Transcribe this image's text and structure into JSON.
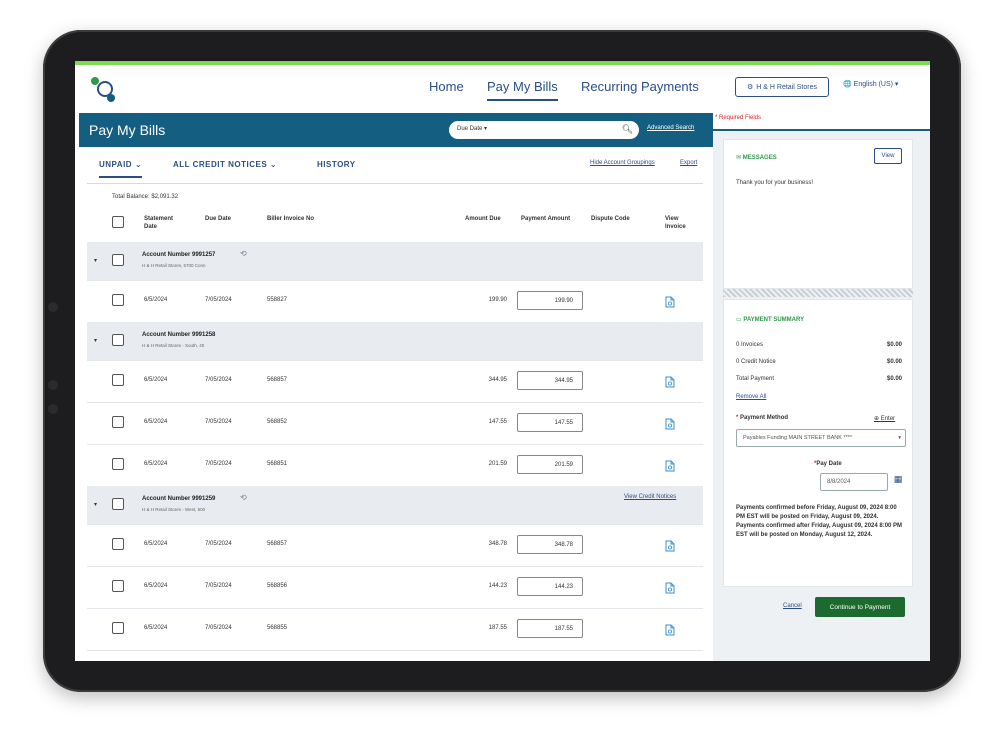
{
  "nav": {
    "home": "Home",
    "pay_my_bills": "Pay My Bills",
    "recurring": "Recurring Payments",
    "store": "H & H Retail Stores",
    "language": "English (US) ▾"
  },
  "header": {
    "title": "Pay My Bills",
    "search_select": "Due Date ▾",
    "advanced_search": "Advanced Search",
    "required": "* Required Fields"
  },
  "tabs": {
    "unpaid": "UNPAID",
    "credit_notices": "ALL CREDIT NOTICES",
    "history": "HISTORY",
    "hide_link": "Hide Account Groupings",
    "export": "Export"
  },
  "total_balance": "Total Balance: $2,091.32",
  "columns": {
    "statement_date": "Statement Date",
    "due_date": "Due Date",
    "biller_invoice": "Biller Invoice No",
    "amount_due": "Amount Due",
    "payment_amount": "Payment Amount",
    "dispute_code": "Dispute Code",
    "view_invoice": "View Invoice"
  },
  "groups": [
    {
      "account": "Account Number 9991257",
      "sub": "H & H Retail Stores, 5700 Conn",
      "recurring": true,
      "credit_link": "",
      "rows": [
        {
          "statement": "6/5/2024",
          "due": "7/05/2024",
          "invoice": "558827",
          "amount": "199.90",
          "payment": "199.90"
        }
      ]
    },
    {
      "account": "Account Number 9991258",
      "sub": "H & H Retail Stores - South, 40",
      "recurring": false,
      "credit_link": "",
      "rows": [
        {
          "statement": "6/5/2024",
          "due": "7/05/2024",
          "invoice": "568857",
          "amount": "344.95",
          "payment": "344.95"
        },
        {
          "statement": "6/5/2024",
          "due": "7/05/2024",
          "invoice": "568852",
          "amount": "147.55",
          "payment": "147.55"
        },
        {
          "statement": "6/5/2024",
          "due": "7/05/2024",
          "invoice": "568851",
          "amount": "201.59",
          "payment": "201.59"
        }
      ]
    },
    {
      "account": "Account Number 9991259",
      "sub": "H & H Retail Stores - West, 500",
      "recurring": true,
      "credit_link": "View Credit Notices",
      "rows": [
        {
          "statement": "6/5/2024",
          "due": "7/05/2024",
          "invoice": "568857",
          "amount": "348.78",
          "payment": "348.78"
        },
        {
          "statement": "6/5/2024",
          "due": "7/05/2024",
          "invoice": "568856",
          "amount": "144.23",
          "payment": "144.23"
        },
        {
          "statement": "6/5/2024",
          "due": "7/05/2024",
          "invoice": "568855",
          "amount": "187.55",
          "payment": "187.55"
        }
      ]
    }
  ],
  "messages": {
    "title": "MESSAGES",
    "view": "View",
    "text": "Thank you for your business!"
  },
  "summary": {
    "title": "PAYMENT SUMMARY",
    "invoices_label": "0 Invoices",
    "invoices_value": "$0.00",
    "credit_label": "0 Credit Notice",
    "credit_value": "$0.00",
    "total_label": "Total Payment",
    "total_value": "$0.00",
    "remove_all": "Remove All",
    "method_label": "Payment Method",
    "enter": "Enter",
    "method_value": "Payables Funding MAIN STREET BANK ****",
    "pay_date_label": "Pay Date",
    "pay_date_value": "8/8/2024",
    "note": "Payments confirmed before Friday, August 09, 2024 8:00 PM EST will be posted on Friday, August 09, 2024. Payments confirmed after Friday, August 09, 2024 8:00 PM EST will be posted on Monday, August 12, 2024.",
    "cancel": "Cancel",
    "continue": "Continue to Payment"
  },
  "colors": {
    "brand": "#145e82",
    "link": "#2a4e86",
    "green": "#1c6a2f",
    "accent": "#7ed957"
  }
}
